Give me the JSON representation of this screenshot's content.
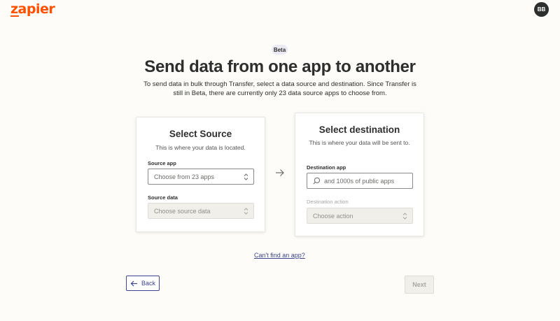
{
  "header": {
    "logo_text": "zapier",
    "brand_color": "#ff4f00",
    "avatar_initials": "BB"
  },
  "hero": {
    "badge": "Beta",
    "title": "Send data from one app to another",
    "subtitle": "To send data in bulk through Transfer, select a data source and destination. Since Transfer is still in Beta, there are currently only 23 data source apps to choose from."
  },
  "source": {
    "heading": "Select Source",
    "description": "This is where your data is located.",
    "app_label": "Source app",
    "app_placeholder": "Choose from 23 apps",
    "data_label": "Source data",
    "data_placeholder": "Choose source data"
  },
  "destination": {
    "heading": "Select destination",
    "description": "This is where your data will be sent to.",
    "app_label": "Destination app",
    "app_placeholder": "and 1000s of public apps",
    "action_label": "Destination action",
    "action_placeholder": "Choose action"
  },
  "links": {
    "cant_find": "Can't find an app?"
  },
  "nav": {
    "back_label": "Back",
    "next_label": "Next"
  },
  "colors": {
    "link": "#3d4592",
    "text": "#2d2e2e"
  }
}
